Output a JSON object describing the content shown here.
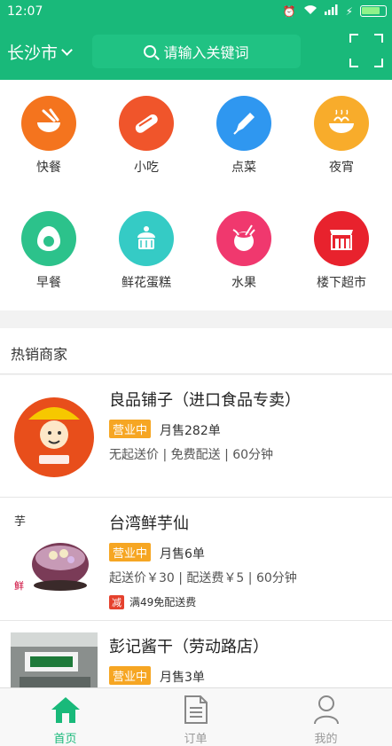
{
  "status": {
    "time": "12:07"
  },
  "header": {
    "city": "长沙市",
    "search_placeholder": "请输入关键词"
  },
  "categories": [
    {
      "label": "快餐",
      "color": "#f4741e",
      "icon": "bowl-chopsticks-icon"
    },
    {
      "label": "小吃",
      "color": "#f0552b",
      "icon": "hotdog-icon"
    },
    {
      "label": "点菜",
      "color": "#2f97f0",
      "icon": "pen-icon"
    },
    {
      "label": "夜宵",
      "color": "#f8ac2b",
      "icon": "noodle-bowl-icon"
    },
    {
      "label": "早餐",
      "color": "#2cc28b",
      "icon": "egg-icon"
    },
    {
      "label": "鲜花蛋糕",
      "color": "#35cbc5",
      "icon": "cake-icon"
    },
    {
      "label": "水果",
      "color": "#f0386e",
      "icon": "coconut-icon"
    },
    {
      "label": "楼下超市",
      "color": "#e8222d",
      "icon": "store-icon"
    }
  ],
  "hot_section": {
    "title": "热销商家"
  },
  "shops": [
    {
      "name": "良品铺子（进口食品专卖）",
      "tag": "营业中",
      "sales": "月售282单",
      "meta": "无起送价 | 免费配送 | 60分钟"
    },
    {
      "name": "台湾鲜芋仙",
      "tag": "营业中",
      "sales": "月售6单",
      "meta": "起送价￥30 | 配送费￥5 | 60分钟",
      "promo_badge": "减",
      "promo_text": "满49免配送费"
    },
    {
      "name": "彭记酱干（劳动路店）",
      "tag": "营业中",
      "sales": "月售3单"
    }
  ],
  "tabbar": {
    "tabs": [
      {
        "label": "首页",
        "active": true
      },
      {
        "label": "订单",
        "active": false
      },
      {
        "label": "我的",
        "active": false
      }
    ],
    "active_color": "#19b97a",
    "inactive_color": "#999999"
  }
}
